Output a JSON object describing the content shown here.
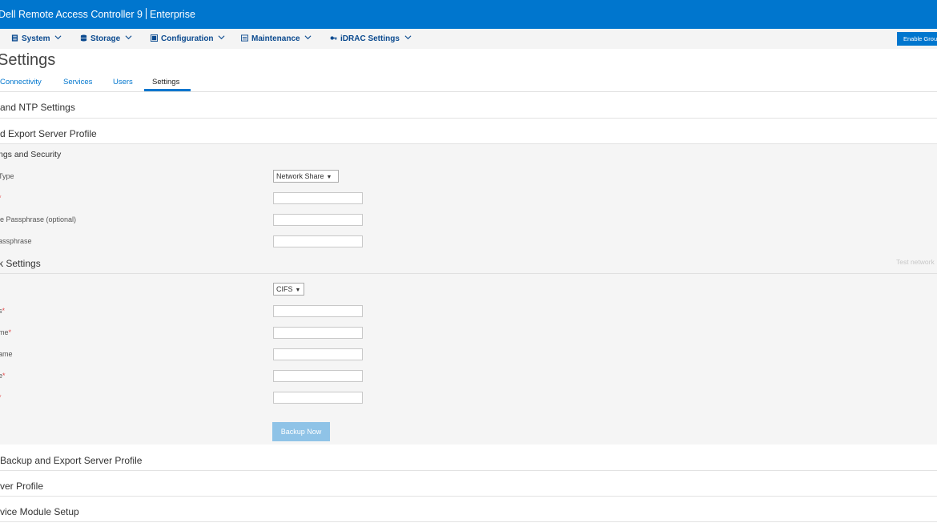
{
  "banner": {
    "title": "Dell Remote Access Controller 9",
    "edition": "Enterprise"
  },
  "nav": {
    "items": [
      {
        "label": "System",
        "icon": "server-icon"
      },
      {
        "label": "Storage",
        "icon": "database-icon"
      },
      {
        "label": "Configuration",
        "icon": "configuration-icon"
      },
      {
        "label": "Maintenance",
        "icon": "maintenance-icon"
      },
      {
        "label": "iDRAC Settings",
        "icon": "keys-icon"
      }
    ],
    "enable_button": "Enable Group Manager"
  },
  "page": {
    "title": "Settings"
  },
  "tabs": [
    {
      "label": "Connectivity",
      "active": false
    },
    {
      "label": "Services",
      "active": false
    },
    {
      "label": "Users",
      "active": false
    },
    {
      "label": "Settings",
      "active": true
    }
  ],
  "sections": {
    "ntp": "and NTP Settings",
    "backup": "d Export Server Profile",
    "auto_backup": "Backup and Export Server Profile",
    "server_profile": "ver Profile",
    "service_module": "vice Module Setup"
  },
  "file_settings": {
    "heading": "ngs and Security",
    "type_label": "Type",
    "type_value": "Network Share",
    "field2_label": "",
    "passphrase_label": "le Passphrase (optional)",
    "confirm_label": "assphrase"
  },
  "network_settings": {
    "heading": "k Settings",
    "test_link": "Test network",
    "protocol_value": "CIFS",
    "field1_label": "s",
    "field2_label": "me",
    "field3_label": "ame",
    "field4_label": "e",
    "field5_label": "",
    "backup_button": "Backup Now"
  },
  "colors": {
    "brand": "#0076ce",
    "nav_text": "#0b4a8f",
    "required": "#e34a4a",
    "disabled_button": "#8fc3e7"
  }
}
